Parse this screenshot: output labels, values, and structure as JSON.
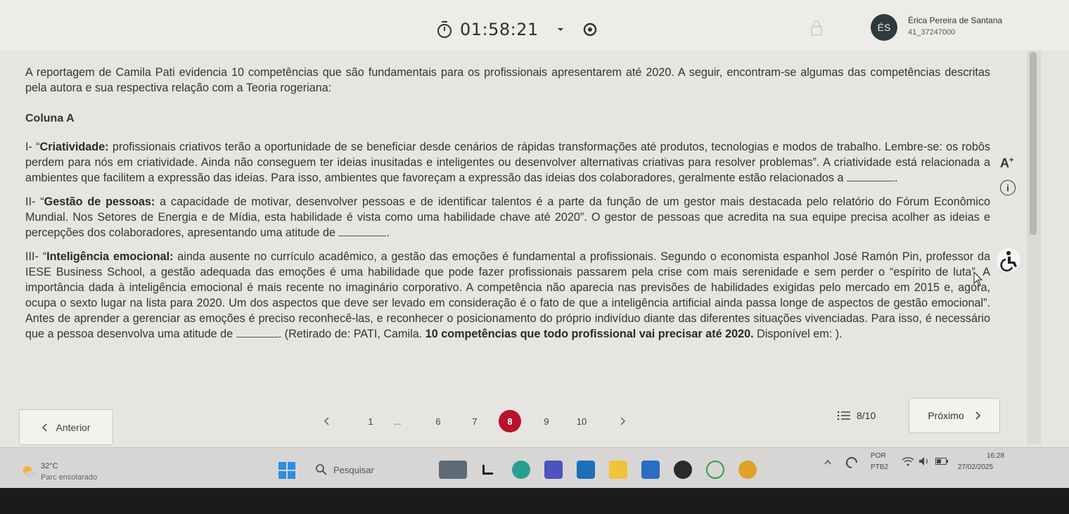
{
  "header": {
    "timer": "01:58:21",
    "user_initials": "ÉS",
    "user_name": "Érica Pereira de Santana",
    "user_id": "41_37247000"
  },
  "question": {
    "intro": "A reportagem de Camila Pati evidencia 10 competências que são fundamentais para os profissionais apresentarem até 2020. A seguir, encontram-se algumas das competências descritas pela autora e sua respectiva relação com a Teoria rogeriana:",
    "column_title": "Coluna A",
    "item1_prefix": "I- “",
    "item1_bold": "Criatividade:",
    "item1_text": " profissionais criativos terão a oportunidade de se beneficiar desde cenários de rápidas transformações até produtos, tecnologias e modos de trabalho. Lembre-se: os robôs perdem para nós em criatividade. Ainda não conseguem ter ideias inusitadas e inteligentes ou desenvolver alternativas criativas para resolver problemas”. A criatividade está relacionada a ambientes que facilitem a expressão das ideias. Para isso, ambientes que favoreçam a expressão das ideias dos colaboradores, geralmente estão relacionados a ",
    "item1_end": ".",
    "item2_prefix": "II- “",
    "item2_bold": "Gestão de pessoas:",
    "item2_text": " a capacidade de motivar, desenvolver pessoas e de identificar talentos é a parte da função de um gestor mais destacada pelo relatório do Fórum Econômico Mundial. Nos Setores de Energia e de Mídia, esta habilidade é vista como uma habilidade chave até 2020”. O gestor de pessoas que acredita na sua equipe precisa acolher as ideias e percepções dos colaboradores, apresentando uma atitude de ",
    "item2_end": ".",
    "item3_prefix": "III- “",
    "item3_bold": "Inteligência emocional:",
    "item3_text": " ainda ausente no currículo acadêmico, a gestão das emoções é fundamental a profissionais. Segundo o economista espanhol José Ramón Pin, professor da IESE Business School, a gestão adequada das emoções é uma habilidade que pode fazer profissionais passarem pela crise com mais serenidade e sem perder o “espírito de luta”. A importância dada à inteligência emocional é mais recente no imaginário corporativo. A competência não aparecia nas previsões de habilidades exigidas pelo mercado em 2015 e, agora, ocupa o sexto lugar na lista para 2020. Um dos aspectos que deve ser levado em consideração é o fato de que a inteligência artificial ainda passa longe de aspectos de gestão emocional”. Antes de aprender a gerenciar as emoções é preciso reconhecê-las, e reconhecer o posicionamento do próprio indivíduo diante das diferentes situações vivenciadas. Para isso, é necessário que a pessoa desenvolva uma atitude de ",
    "item3_after_blank": ". (Retirado de: PATI, Camila. ",
    "item3_bold2": "10 competências que todo profissional vai precisar até 2020.",
    "item3_end": " Disponível em: )."
  },
  "tools": {
    "font_size_label": "A",
    "font_size_sup": "+",
    "info_label": "i"
  },
  "pager": {
    "prev_label": "Anterior",
    "next_label": "Próximo",
    "pages": [
      "1",
      "...",
      "6",
      "7",
      "8",
      "9",
      "10"
    ],
    "current": "8",
    "progress_label": "8/10"
  },
  "taskbar": {
    "temperature": "32°C",
    "weather": "Parc ensolarado",
    "search_label": "Pesquisar",
    "lang_top": "POR",
    "lang_bottom": "PTB2",
    "time": "16:28",
    "date": "27/02/2025"
  },
  "colors": {
    "accent_active_page": "#b8122a",
    "avatar_bg": "#2e3b3c"
  }
}
